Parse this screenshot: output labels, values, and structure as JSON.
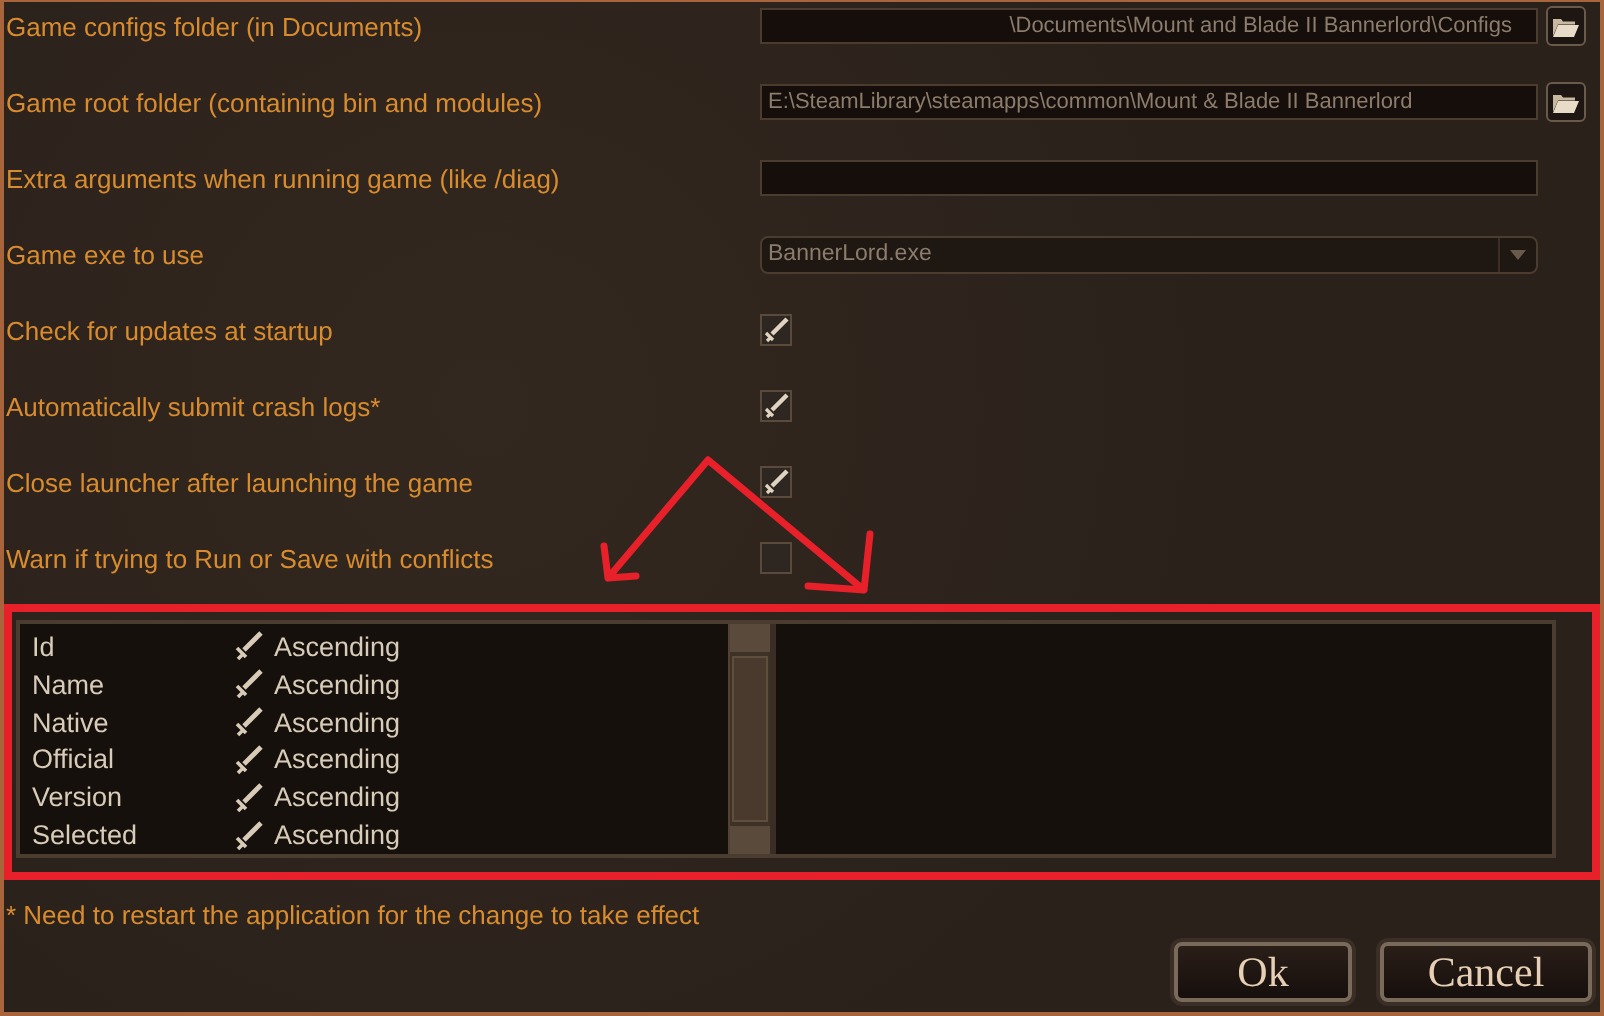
{
  "settings": [
    {
      "kind": "path",
      "label": "Game configs folder (in Documents)",
      "value": "\\Documents\\Mount and Blade II Bannerlord\\Configs",
      "right_aligned": true
    },
    {
      "kind": "path",
      "label": "Game root folder (containing bin and modules)",
      "value": "E:\\SteamLibrary\\steamapps\\common\\Mount & Blade II Bannerlord",
      "right_aligned": false
    },
    {
      "kind": "text",
      "label": "Extra arguments when running game (like /diag)"
    },
    {
      "kind": "dropdown",
      "label": "Game exe to use",
      "value": "BannerLord.exe"
    },
    {
      "kind": "checkbox",
      "label": "Check for updates at startup",
      "checked": true
    },
    {
      "kind": "checkbox",
      "label": "Automatically submit crash logs*",
      "checked": true
    },
    {
      "kind": "checkbox",
      "label": "Close launcher after launching the game",
      "checked": true
    },
    {
      "kind": "checkbox",
      "label": "Warn if trying to Run or Save with conflicts",
      "checked": false
    }
  ],
  "sort_list": {
    "rows": [
      {
        "name": "Id",
        "checked": true,
        "order": "Ascending"
      },
      {
        "name": "Name",
        "checked": true,
        "order": "Ascending"
      },
      {
        "name": "Native",
        "checked": true,
        "order": "Ascending"
      },
      {
        "name": "Official",
        "checked": true,
        "order": "Ascending"
      },
      {
        "name": "Version",
        "checked": true,
        "order": "Ascending"
      },
      {
        "name": "Selected",
        "checked": true,
        "order": "Ascending"
      }
    ]
  },
  "footnote": "* Need to restart the application for the change to take effect",
  "buttons": [
    "Ok",
    "Cancel"
  ]
}
